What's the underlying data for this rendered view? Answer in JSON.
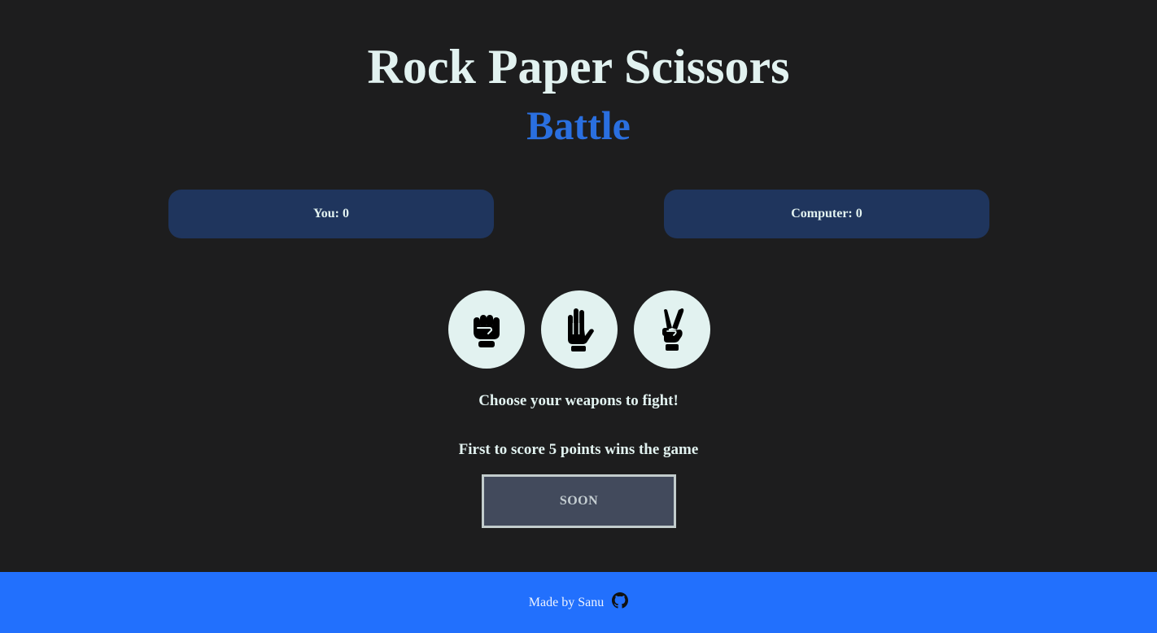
{
  "header": {
    "title": "Rock Paper Scissors",
    "subtitle": "Battle"
  },
  "scoreboard": {
    "player_label": "You: 0",
    "computer_label": "Computer: 0"
  },
  "weapons": [
    {
      "name": "rock",
      "icon": "fist-icon"
    },
    {
      "name": "paper",
      "icon": "open-hand-icon"
    },
    {
      "name": "scissors",
      "icon": "peace-hand-icon"
    }
  ],
  "messages": {
    "choose": "Choose your weapons to fight!",
    "rule": "First to score 5 points wins the game"
  },
  "result_button": {
    "label": "SOON"
  },
  "footer": {
    "text": "Made by Sanu",
    "icon": "github-icon"
  },
  "colors": {
    "background": "#1d1d1e",
    "accent": "#2a6fe0",
    "score_panel": "#1f355d",
    "footer": "#2270fd",
    "weapon_circle": "#e2f2f0"
  }
}
